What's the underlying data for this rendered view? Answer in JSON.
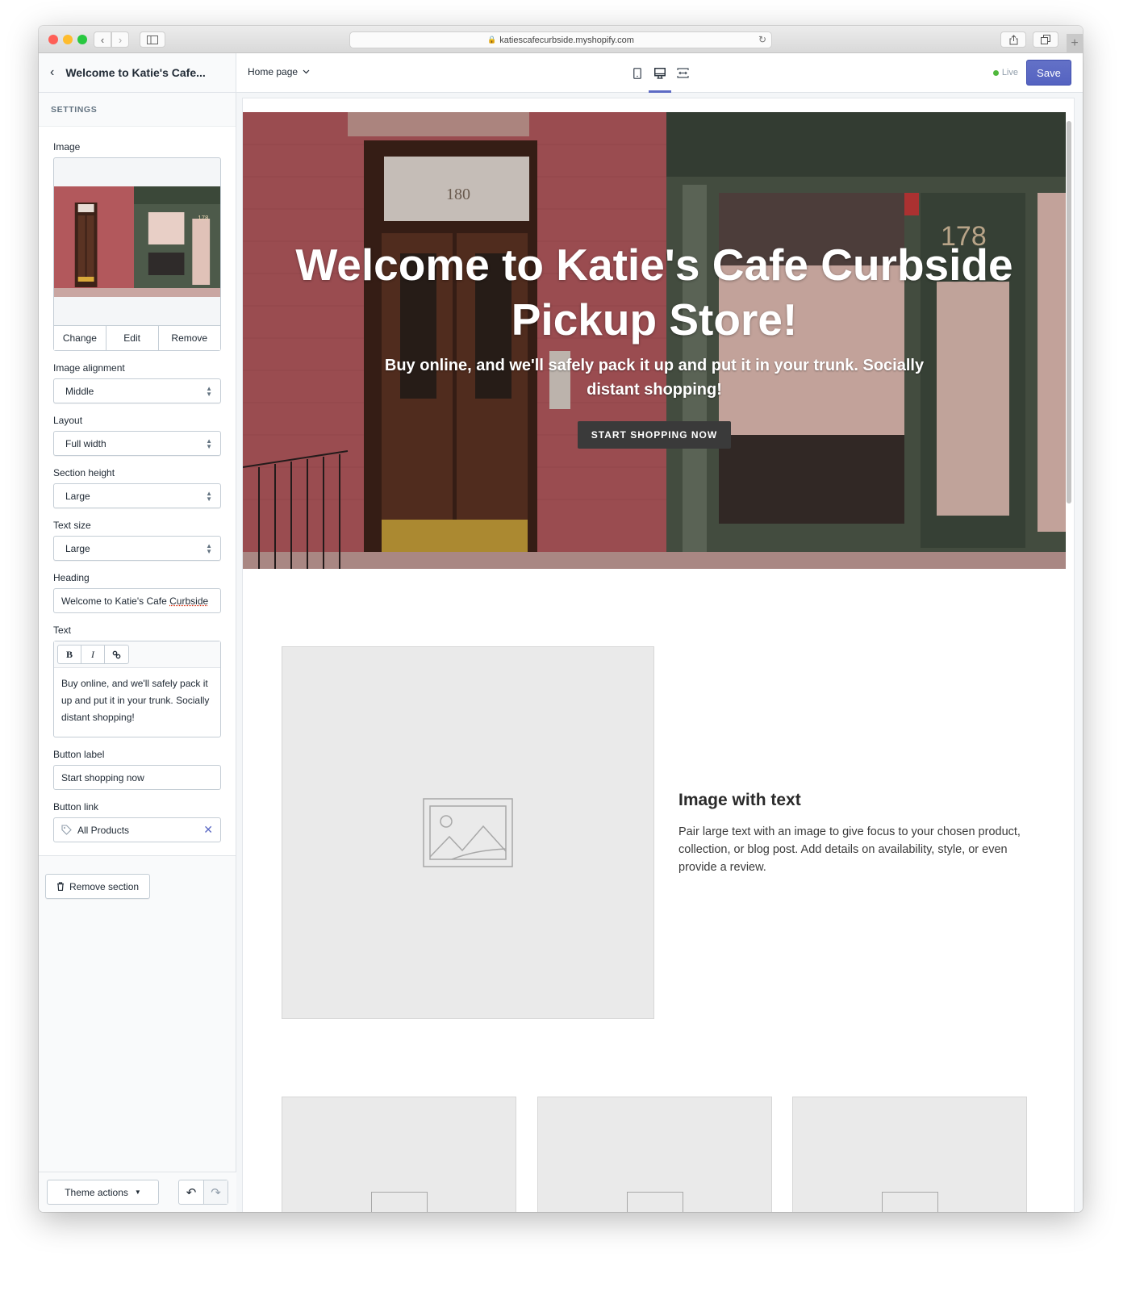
{
  "browser": {
    "url": "katiescafecurbside.myshopify.com",
    "icons": [
      "back-icon",
      "forward-icon",
      "sidebar-icon",
      "lock-icon",
      "reload-icon",
      "share-icon",
      "tabs-icon",
      "new-tab-icon"
    ]
  },
  "sidebar": {
    "title": "Welcome to Katie's Cafe...",
    "section_label": "SETTINGS",
    "image": {
      "label": "Image",
      "actions": [
        "Change",
        "Edit",
        "Remove"
      ]
    },
    "fields": {
      "image_alignment": {
        "label": "Image alignment",
        "value": "Middle"
      },
      "layout": {
        "label": "Layout",
        "value": "Full width"
      },
      "section_height": {
        "label": "Section height",
        "value": "Large"
      },
      "text_size": {
        "label": "Text size",
        "value": "Large"
      },
      "heading": {
        "label": "Heading",
        "value_start": "Welcome to Katie's Cafe ",
        "value_misspelled": "Curbside"
      },
      "text": {
        "label": "Text",
        "toolbar": {
          "bold": "B",
          "italic": "I"
        },
        "value": "Buy online, and we'll safely pack it up and put it in your trunk. Socially distant shopping!"
      },
      "button_label": {
        "label": "Button label",
        "value": "Start shopping now"
      },
      "button_link": {
        "label": "Button link",
        "value": "All Products"
      }
    },
    "remove_section": "Remove section",
    "theme_actions": "Theme actions"
  },
  "topbar": {
    "page": "Home page",
    "devices": [
      "mobile",
      "desktop",
      "full-width"
    ],
    "active_device": "desktop",
    "status": "Live",
    "save": "Save",
    "colors": {
      "accent": "#5c6ac4",
      "live": "#50b83c"
    }
  },
  "preview": {
    "hero": {
      "title": "Welcome to Katie's Cafe Curbside Pickup Store!",
      "text": "Buy online, and we'll safely pack it up and put it in your trunk. Socially distant shopping!",
      "button": "START SHOPPING NOW"
    },
    "image_with_text": {
      "title": "Image with text",
      "body": "Pair large text with an image to give focus to your chosen product, collection, or blog post. Add details on availability, style, or even provide a review."
    },
    "collection_placeholders": 3
  }
}
